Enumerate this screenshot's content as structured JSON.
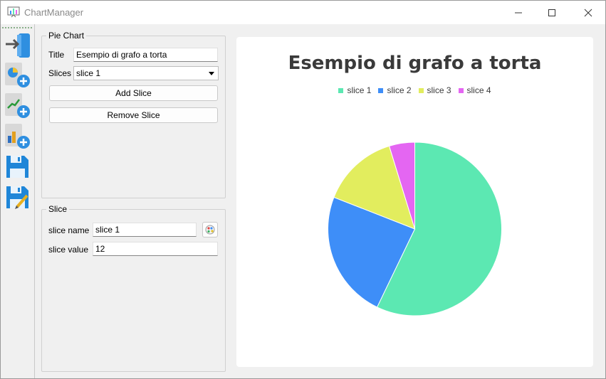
{
  "window": {
    "title": "ChartManager"
  },
  "toolbar": {
    "items": [
      {
        "name": "import-icon"
      },
      {
        "name": "add-pie-chart-icon"
      },
      {
        "name": "add-line-chart-icon"
      },
      {
        "name": "add-bar-chart-icon"
      },
      {
        "name": "save-icon"
      },
      {
        "name": "save-as-icon"
      }
    ]
  },
  "pie_group": {
    "title": "Pie Chart",
    "title_label": "Title",
    "title_value": "Esempio di grafo a torta",
    "slices_label": "Slices",
    "slices_selected": "slice 1",
    "add_slice": "Add Slice",
    "remove_slice": "Remove Slice"
  },
  "slice_group": {
    "title": "Slice",
    "name_label": "slice name",
    "name_value": "slice 1",
    "value_label": "slice value",
    "value_value": "12"
  },
  "chart_data": {
    "type": "pie",
    "title": "Esempio di grafo a torta",
    "legend_position": "top",
    "labels": [
      "slice 1",
      "slice 2",
      "slice 3",
      "slice 4"
    ],
    "values": [
      12,
      5,
      3,
      1
    ],
    "colors": [
      "#5ce8b2",
      "#3e8ef8",
      "#e2ed5e",
      "#e466f2"
    ]
  }
}
